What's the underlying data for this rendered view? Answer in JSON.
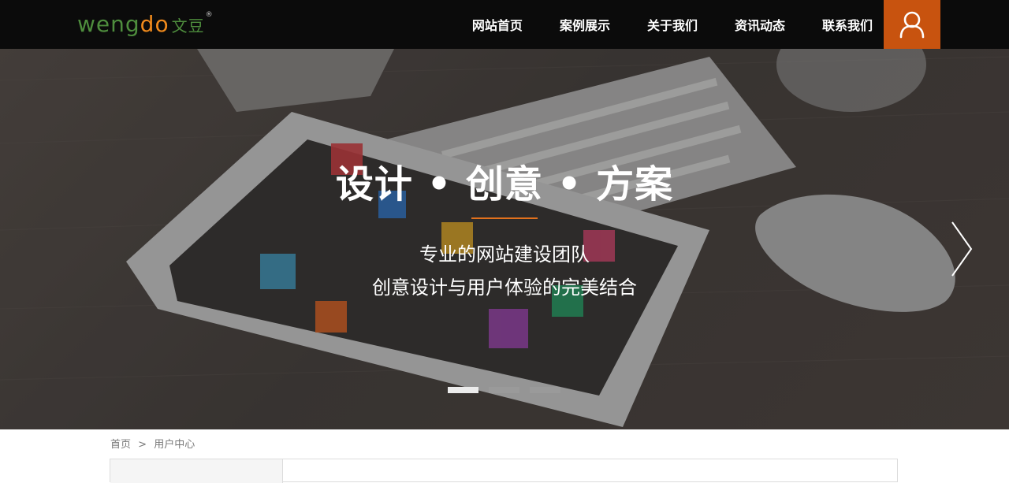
{
  "logo": {
    "latin": "wengdo",
    "chinese": "文豆",
    "reg": "®"
  },
  "nav": {
    "items": [
      {
        "label": "网站首页"
      },
      {
        "label": "案例展示"
      },
      {
        "label": "关于我们"
      },
      {
        "label": "资讯动态"
      },
      {
        "label": "联系我们"
      }
    ]
  },
  "banner": {
    "headline": "设计 • 创意 • 方案",
    "subline_1": "专业的网站建设团队",
    "subline_2": "创意设计与用户体验的完美结合",
    "slides": 3,
    "active_slide": 1
  },
  "breadcrumb": {
    "home": "首页",
    "separator": ">",
    "current": "用户中心"
  },
  "colors": {
    "header_bg": "#0b0b0b",
    "accent": "#c8530f",
    "logo_green": "#4e8d3d",
    "logo_orange": "#f08a1c",
    "rule": "#e2711d"
  },
  "icons": {
    "user": "user-icon",
    "next": "chevron-right-icon"
  }
}
